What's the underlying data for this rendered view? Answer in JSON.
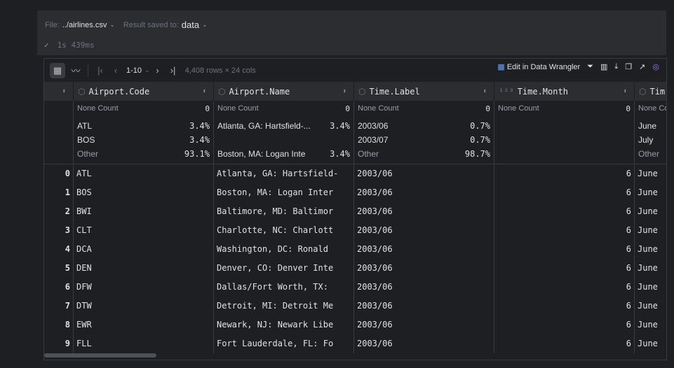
{
  "cell": {
    "file_label": "File:",
    "file_value": "../airlines.csv",
    "saved_label": "Result saved to:",
    "saved_value": "data",
    "duration": "1s 439ms"
  },
  "toolbar": {
    "page_range": "1-10",
    "size_info": "4,408 rows × 24 cols",
    "wrangler": "Edit in Data Wrangler"
  },
  "columns": [
    {
      "name": "Airport.Code",
      "type_icon": "cube-icon",
      "none_label": "None Count",
      "none": "0",
      "top": [
        [
          "ATL",
          "3.4%"
        ],
        [
          "BOS",
          "3.4%"
        ]
      ],
      "other": [
        "Other",
        "93.1%"
      ]
    },
    {
      "name": "Airport.Name",
      "type_icon": "cube-icon",
      "none_label": "None Count",
      "none": "0",
      "top": [
        [
          "Atlanta, GA: Hartsfield-...",
          "3.4%"
        ],
        [
          "Boston, MA: Logan Inte",
          "3.4%"
        ]
      ],
      "other": null
    },
    {
      "name": "Time.Label",
      "type_icon": "cube-icon",
      "none_label": "None Count",
      "none": "0",
      "top": [
        [
          "2003/06",
          "0.7%"
        ],
        [
          "2003/07",
          "0.7%"
        ]
      ],
      "other": [
        "Other",
        "98.7%"
      ]
    },
    {
      "name": "Time.Month",
      "type_icon": "numeric-icon",
      "none_label": "None Count",
      "none": "0",
      "top": [],
      "other": null
    },
    {
      "name": "Tim",
      "type_icon": "cube-icon",
      "none_label": "None Co",
      "none": "",
      "top": [
        [
          "June",
          ""
        ],
        [
          "July",
          ""
        ]
      ],
      "other": [
        "Other",
        ""
      ]
    }
  ],
  "rows": [
    [
      "0",
      "ATL",
      "Atlanta, GA: Hartsfield-",
      "2003/06",
      "6",
      "June"
    ],
    [
      "1",
      "BOS",
      "Boston, MA: Logan Inter",
      "2003/06",
      "6",
      "June"
    ],
    [
      "2",
      "BWI",
      "Baltimore, MD: Baltimor",
      "2003/06",
      "6",
      "June"
    ],
    [
      "3",
      "CLT",
      "Charlotte, NC: Charlott",
      "2003/06",
      "6",
      "June"
    ],
    [
      "4",
      "DCA",
      "Washington, DC: Ronald ",
      "2003/06",
      "6",
      "June"
    ],
    [
      "5",
      "DEN",
      "Denver, CO: Denver Inte",
      "2003/06",
      "6",
      "June"
    ],
    [
      "6",
      "DFW",
      "Dallas/Fort Worth, TX: ",
      "2003/06",
      "6",
      "June"
    ],
    [
      "7",
      "DTW",
      "Detroit, MI: Detroit Me",
      "2003/06",
      "6",
      "June"
    ],
    [
      "8",
      "EWR",
      "Newark, NJ: Newark Libe",
      "2003/06",
      "6",
      "June"
    ],
    [
      "9",
      "FLL",
      "Fort Lauderdale, FL: Fo",
      "2003/06",
      "6",
      "June"
    ]
  ]
}
